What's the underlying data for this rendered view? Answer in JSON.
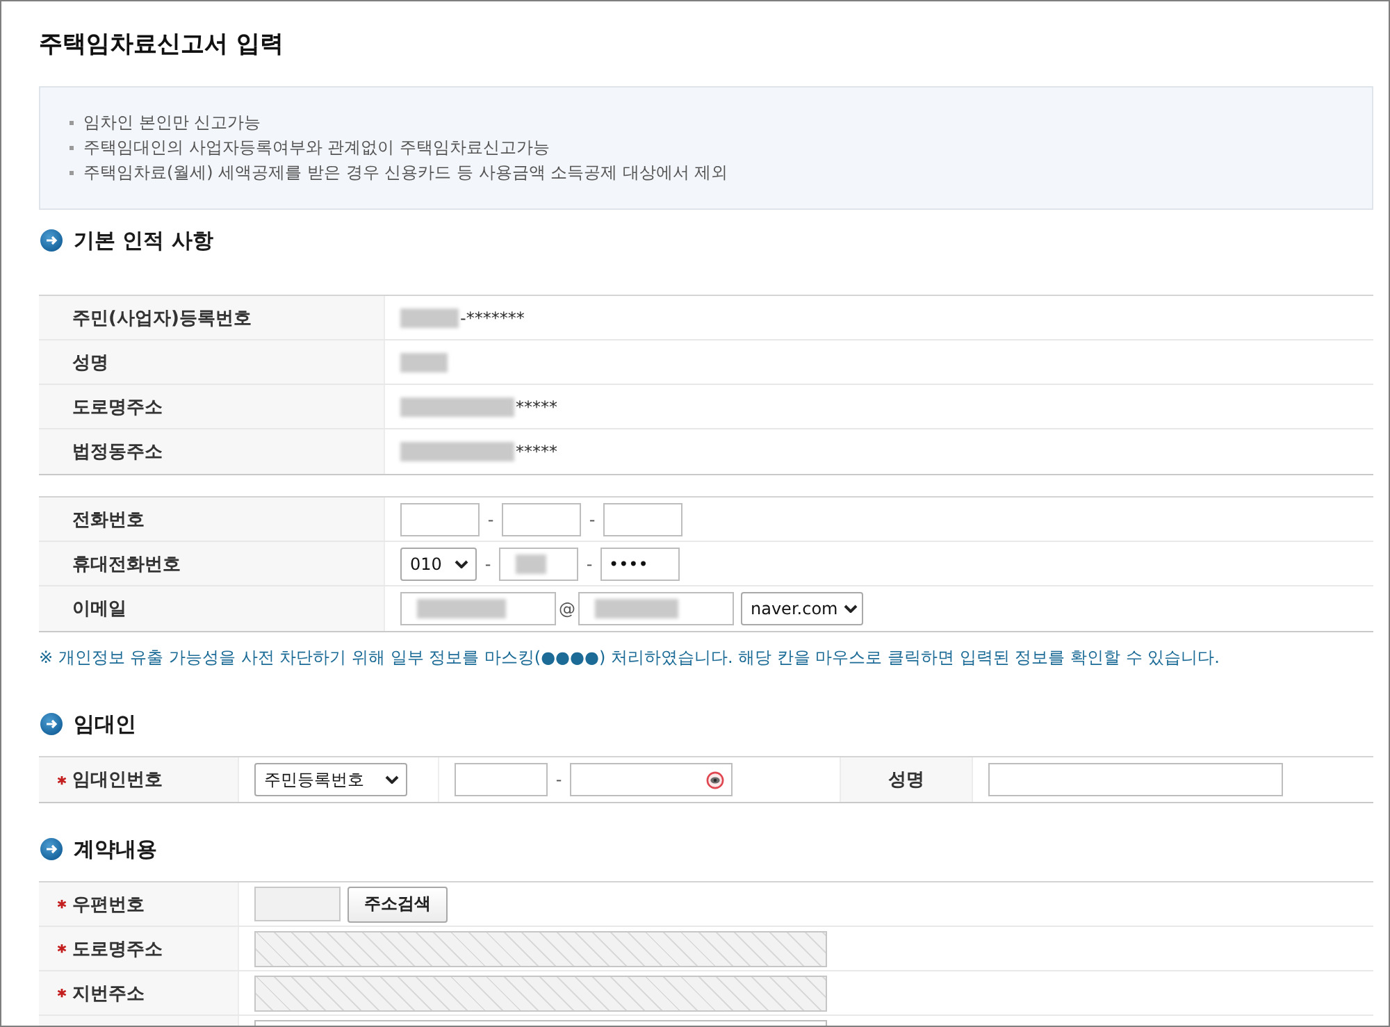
{
  "page": {
    "title": "주택임차료신고서 입력"
  },
  "notices": [
    "임차인 본인만 신고가능",
    "주택임대인의 사업자등록여부와 관계없이 주택임차료신고가능",
    "주택임차료(월세) 세액공제를 받은 경우 신용카드 등 사용금액 소득공제 대상에서 제외"
  ],
  "basic_info": {
    "heading": "기본 인적 사항",
    "fixed_rows": [
      {
        "label": "주민(사업자)등록번호",
        "redacted": true,
        "value": "-*******"
      },
      {
        "label": "성명",
        "redacted": true
      },
      {
        "label": "도로명주소",
        "redacted": true,
        "value": "*****"
      },
      {
        "label": "법정동주소",
        "redacted": true,
        "value": "*****"
      }
    ],
    "contact_rows": [
      {
        "label": "전화번호",
        "kind": "phone",
        "fields": [
          {
            "kind": "input",
            "redacted": false
          },
          {
            "kind": "input",
            "prefix": "-",
            "redacted": false
          },
          {
            "kind": "input",
            "prefix": "-",
            "redacted": false
          }
        ]
      },
      {
        "label": "휴대전화번호",
        "kind": "phone",
        "fields": [
          {
            "kind": "select",
            "value": "010",
            "redacted": false
          },
          {
            "kind": "input",
            "prefix": "-",
            "redacted": true
          },
          {
            "kind": "input",
            "prefix": "-",
            "value": "••••",
            "redacted": false
          }
        ]
      },
      {
        "label": "이메일",
        "kind": "email",
        "fields": [
          {
            "kind": "input",
            "redacted": true
          },
          {
            "kind": "input",
            "prefix": "@",
            "redacted": true
          },
          {
            "kind": "select",
            "value": "naver.com",
            "redacted": false
          }
        ]
      }
    ]
  },
  "masking_note": "※ 개인정보 유출 가능성을 사전 차단하기 위해 일부 정보를 마스킹(●●●●) 처리하였습니다. 해당 칸을 마우스로 클릭하면 입력된 정보를 확인할 수 있습니다.",
  "landlord": {
    "heading": "임대인",
    "id_label": "임대인번호",
    "id_required": true,
    "id_type": "주민등록번호",
    "id_fields": [
      {
        "kind": "input",
        "eye_toggle": false
      },
      {
        "kind": "input",
        "prefix": "-",
        "eye_toggle": true
      }
    ],
    "name_label": "성명",
    "name_required": false
  },
  "contract": {
    "heading": "계약내용",
    "rows": [
      {
        "label": "우편번호",
        "required": true,
        "kind": "postcode",
        "button": "주소검색"
      },
      {
        "label": "도로명주소",
        "required": true,
        "kind": "readonly"
      },
      {
        "label": "지번주소",
        "required": true,
        "kind": "readonly"
      },
      {
        "kind": "input"
      }
    ]
  }
}
